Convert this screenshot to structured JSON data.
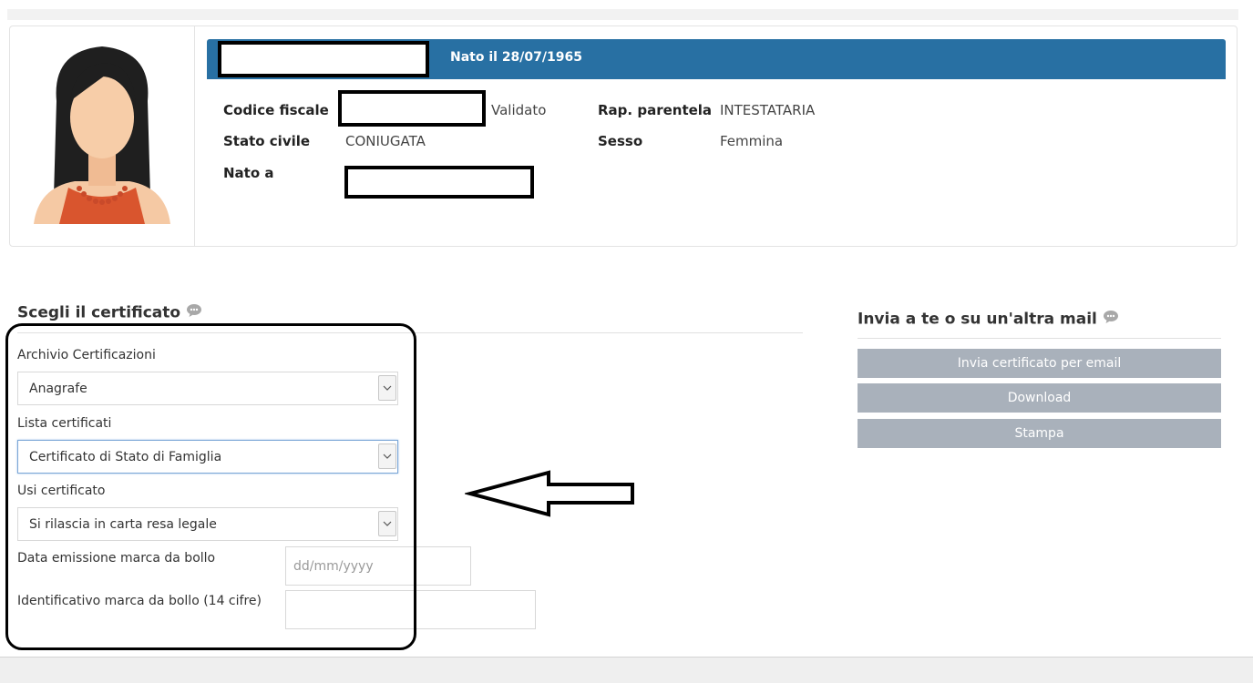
{
  "person": {
    "born_label": "Nato il 28/07/1965",
    "fields": {
      "codice_fiscale": {
        "label": "Codice fiscale",
        "status": "Validato"
      },
      "rap_parentela": {
        "label": "Rap. parentela",
        "value": "INTESTATARIA"
      },
      "stato_civile": {
        "label": "Stato civile",
        "value": "CONIUGATA"
      },
      "sesso": {
        "label": "Sesso",
        "value": "Femmina"
      },
      "nato_a": {
        "label": "Nato a"
      }
    }
  },
  "certificate": {
    "section_title": "Scegli il certificato",
    "archivio": {
      "label": "Archivio Certificazioni",
      "value": "Anagrafe"
    },
    "lista": {
      "label": "Lista certificati",
      "value": "Certificato di Stato di Famiglia"
    },
    "usi": {
      "label": "Usi certificato",
      "value": "Si rilascia in carta resa legale"
    },
    "data_emissione": {
      "label": "Data emissione marca da bollo",
      "placeholder": "dd/mm/yyyy"
    },
    "identificativo": {
      "label": "Identificativo marca da bollo (14 cifre)",
      "value": ""
    }
  },
  "send": {
    "section_title": "Invia a te o su un'altra mail",
    "buttons": [
      "Invia certificato per email",
      "Download",
      "Stampa"
    ]
  },
  "colors": {
    "header_blue": "#2870a3",
    "button_gray": "#a9b1bb"
  },
  "icons": {
    "help": "speech-bubble-icon",
    "dropdown": "chevron-down-icon"
  }
}
